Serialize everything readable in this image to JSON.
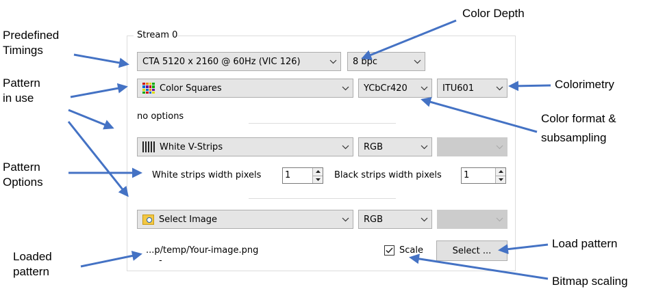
{
  "annotations": {
    "predefined_timings": [
      "Predefined",
      "Timings"
    ],
    "pattern_in_use": [
      "Pattern",
      "in use"
    ],
    "pattern_options": [
      "Pattern",
      "Options"
    ],
    "loaded_pattern": [
      "Loaded",
      "pattern"
    ],
    "color_depth": "Color Depth",
    "colorimetry": "Colorimetry",
    "color_format": [
      "Color format &",
      "subsampling"
    ],
    "load_pattern": "Load pattern",
    "bitmap_scaling": "Bitmap scaling"
  },
  "stream": {
    "title": "Stream 0",
    "timing": "CTA 5120 x 2160 @ 60Hz (VIC 126)",
    "bpc": "8 bpc",
    "pattern1": {
      "name": "Color Squares",
      "format": "YCbCr420",
      "colorimetry": "ITU601",
      "options_text": "no options"
    },
    "pattern2": {
      "name": "White V-Strips",
      "format": "RGB",
      "colorimetry": "",
      "white_label": "White strips width pixels",
      "white_value": "1",
      "black_label": "Black strips width pixels",
      "black_value": "1"
    },
    "pattern3": {
      "name": "Select Image",
      "format": "RGB",
      "colorimetry": "",
      "path": "...p/temp/Your-image.png",
      "dash": "-",
      "scale_label": "Scale",
      "scale_checked": true,
      "select_label": "Select ..."
    }
  },
  "icons": {
    "chevron": "chevron-down-icon",
    "color_squares": "color-squares-icon",
    "vstrips": "v-strips-icon",
    "image": "image-search-icon",
    "arrow_color": "#4472c4"
  }
}
